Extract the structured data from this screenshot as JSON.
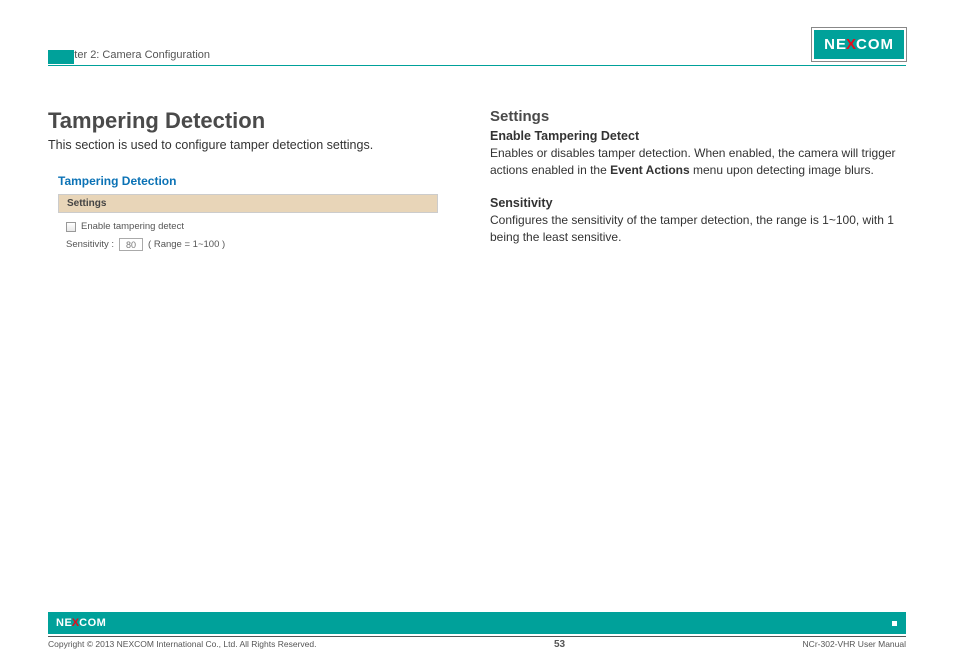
{
  "header": {
    "chapter": "Chapter 2: Camera Configuration",
    "logo_left": "NE",
    "logo_x": "X",
    "logo_right": "COM"
  },
  "left": {
    "title": "Tampering Detection",
    "intro": "This section is used to configure tamper detection settings.",
    "panel_title": "Tampering Detection",
    "settings_label": "Settings",
    "checkbox_label": "Enable tampering detect",
    "sensitivity_label": "Sensitivity :",
    "sensitivity_value": "80",
    "sensitivity_range": "( Range = 1~100 )"
  },
  "right": {
    "heading": "Settings",
    "sub1_title": "Enable Tampering Detect",
    "sub1_pre": "Enables or disables tamper detection. When enabled, the camera will trigger actions enabled in the ",
    "sub1_bold": "Event Actions",
    "sub1_post": " menu upon detecting image blurs.",
    "sub2_title": "Sensitivity",
    "sub2_text": "Configures the sensitivity of the tamper detection, the range is 1~100, with 1 being the least sensitive."
  },
  "footer": {
    "logo_left": "NE",
    "logo_x": "X",
    "logo_right": "COM",
    "copyright": "Copyright © 2013 NEXCOM International Co., Ltd. All Rights Reserved.",
    "page": "53",
    "manual": "NCr-302-VHR User Manual"
  }
}
